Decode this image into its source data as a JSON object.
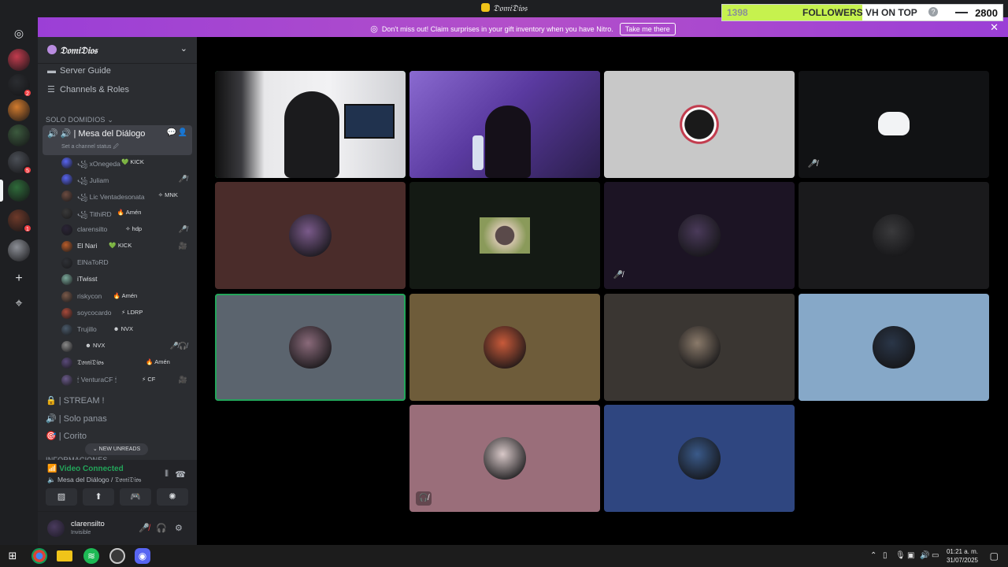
{
  "window": {
    "title": "𝔇𝔬𝔪𝔦𝔇𝔦𝔬𝔰"
  },
  "overlay": {
    "current": "1398",
    "label_prefix": "FOLLOWERS ",
    "label_highlight": "VH ON TOP",
    "goal": "2800",
    "progress": 0.5
  },
  "banner": {
    "message": "Don't miss out! Claim surprises in your gift inventory when you have Nitro.",
    "cta": "Take me there"
  },
  "servers": [
    {
      "name": "server-home",
      "glyph": "discord-icon"
    },
    {
      "name": "server-1",
      "color": "#c23c4e"
    },
    {
      "name": "server-2",
      "color": "#2b2d31",
      "badge": "2"
    },
    {
      "name": "server-3",
      "color": "#d27b2e"
    },
    {
      "name": "server-4",
      "color": "#3c5a3e"
    },
    {
      "name": "server-5",
      "color": "#4b4f56",
      "badge": "5"
    },
    {
      "name": "server-6",
      "color": "#2f6b3a"
    },
    {
      "name": "server-7",
      "color": "#6e3a2a",
      "badge": "1"
    },
    {
      "name": "server-8",
      "color": "#8c8f96"
    }
  ],
  "sidebar": {
    "server_name": "𝔇𝔬𝔪𝔦𝔇𝔦𝔬𝔰",
    "server_guide": "Server Guide",
    "channels_roles": "Channels & Roles",
    "category": "SOLO DOMIDIOS",
    "voice_channel": "🔊 | Mesa del Diálogo",
    "channel_status": "Set a channel status 🖉",
    "members": [
      {
        "name": "꧁ xOnegeda",
        "tag": "💚 KICK",
        "color": "#5865f2",
        "icon": ""
      },
      {
        "name": "꧁ Juliam",
        "tag": "",
        "color": "#5865f2",
        "icon": "🎤̸"
      },
      {
        "name": "꧁ Lic Ventadesonata",
        "tag": "✧ MNK",
        "color": "#6d4c41",
        "icon": ""
      },
      {
        "name": "꧁ TithiRD",
        "tag": "🔥 Amén",
        "color": "#3a3a3a",
        "icon": ""
      },
      {
        "name": "clarensilto",
        "tag": "✧ hdp",
        "color": "#2a2436",
        "icon": "🎤̸"
      },
      {
        "name": "El Nari",
        "tag": "💚 KICK",
        "color": "#b85c2a",
        "icon": "🎥"
      },
      {
        "name": "ElNaToRD",
        "tag": "",
        "color": "#2f3136",
        "icon": ""
      },
      {
        "name": "iTwisst",
        "tag": "",
        "color": "#7aa89a",
        "icon": ""
      },
      {
        "name": "riskycon",
        "tag": "🔥 Amén",
        "color": "#7a5a4a",
        "icon": ""
      },
      {
        "name": "soycocardo",
        "tag": "⚡ LDRP",
        "color": "#a84a3a",
        "icon": ""
      },
      {
        "name": "Trujillo",
        "tag": "☻ NVX",
        "color": "#4a5a6a",
        "icon": ""
      },
      {
        "name": "",
        "tag": "☻ NVX",
        "color": "#8a8a8a",
        "icon": "🎤̸🎧̸"
      },
      {
        "name": "𝔇𝔬𝔪𝔦𝔇𝔦𝔬𝔰",
        "tag": "🔥 Amén",
        "color": "#5a4a7a",
        "icon": ""
      },
      {
        "name": "🕯 VenturaCF 🕯",
        "tag": "⚡ CF",
        "color": "#6a5a8a",
        "icon": "🎥"
      }
    ],
    "other_channels": [
      "🔒 | STREAM !",
      "🔊 | Solo panas",
      "🎯 | Corito"
    ],
    "new_unreads": "⌄  NEW UNREADS",
    "next_category": "INFORMACIONES"
  },
  "rtc": {
    "status": "Video Connected",
    "location": "Mesa del Diálogo / 𝔇𝔬𝔪𝔦𝔇𝔦𝔬𝔰"
  },
  "user": {
    "name": "clarensilto",
    "status": "Invisible"
  },
  "taskbar": {
    "time": "01:21 a. m.",
    "date": "31/07/2025"
  },
  "tiles": [
    {
      "name": "tile-stream-1",
      "bg": "#2a2a2e",
      "kind": "video1",
      "speaking": true
    },
    {
      "name": "tile-stream-2",
      "bg": "#6a4aa0",
      "kind": "video2"
    },
    {
      "name": "tile-logo-monster",
      "bg": "#c8c8c8",
      "kind": "logo"
    },
    {
      "name": "tile-discord-default",
      "bg": "#111214",
      "kind": "discord",
      "muted": true
    },
    {
      "name": "tile-user-5",
      "bg": "#4a2c2a",
      "kind": "avatar",
      "av": "#7a5a8a"
    },
    {
      "name": "tile-user-6",
      "bg": "#141a14",
      "kind": "square",
      "av": "#9a7a6a"
    },
    {
      "name": "tile-user-7",
      "bg": "#1c1424",
      "kind": "avatar",
      "av": "#4a3a5a",
      "muted": true
    },
    {
      "name": "tile-user-8",
      "bg": "#1a1a1c",
      "kind": "avatar",
      "av": "#3a3a3c"
    },
    {
      "name": "tile-user-9",
      "bg": "#5b646e",
      "kind": "avatar",
      "av": "#8a6a7a",
      "speaking": true
    },
    {
      "name": "tile-user-10",
      "bg": "#6e5c3a",
      "kind": "avatar",
      "av": "#c85a3a"
    },
    {
      "name": "tile-user-11",
      "bg": "#3a3632",
      "kind": "avatar",
      "av": "#8a7a6a"
    },
    {
      "name": "tile-user-12",
      "bg": "#86a8c8",
      "kind": "avatar",
      "av": "#2a3648"
    },
    {
      "name": "tile-user-13",
      "bg": "#9a6e7a",
      "kind": "avatar",
      "av": "#d8c8c8",
      "deafened": true
    },
    {
      "name": "tile-user-14",
      "bg": "#2f4680",
      "kind": "avatar",
      "av": "#3a5a8a"
    }
  ]
}
